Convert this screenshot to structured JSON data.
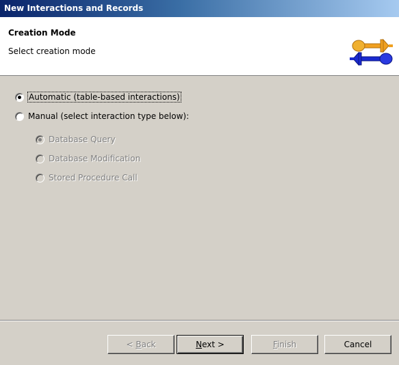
{
  "window": {
    "title": "New Interactions and Records"
  },
  "header": {
    "title": "Creation Mode",
    "description": "Select creation mode",
    "icon": "connector-icon"
  },
  "options": {
    "automatic": {
      "label": "Automatic (table-based interactions)",
      "checked": true,
      "enabled": true
    },
    "manual": {
      "label": "Manual (select interaction type below):",
      "checked": false,
      "enabled": true
    },
    "interaction_types": [
      {
        "label": "Database Query",
        "checked": true,
        "enabled": false
      },
      {
        "label": "Database Modification",
        "checked": false,
        "enabled": false
      },
      {
        "label": "Stored Procedure Call",
        "checked": false,
        "enabled": false
      }
    ]
  },
  "buttons": {
    "back": {
      "prefix": "< ",
      "mnemonic": "B",
      "rest": "ack",
      "enabled": false
    },
    "next": {
      "mnemonic": "N",
      "rest": "ext >",
      "enabled": true
    },
    "finish": {
      "mnemonic": "F",
      "rest": "inish",
      "enabled": false
    },
    "cancel": {
      "label": "Cancel",
      "enabled": true
    }
  },
  "colors": {
    "titlebar_start": "#0a246a",
    "titlebar_end": "#a6caf0",
    "dialog_bg": "#d4d0c8",
    "icon_orange": "#f0a020",
    "icon_blue": "#1a2ad0"
  }
}
